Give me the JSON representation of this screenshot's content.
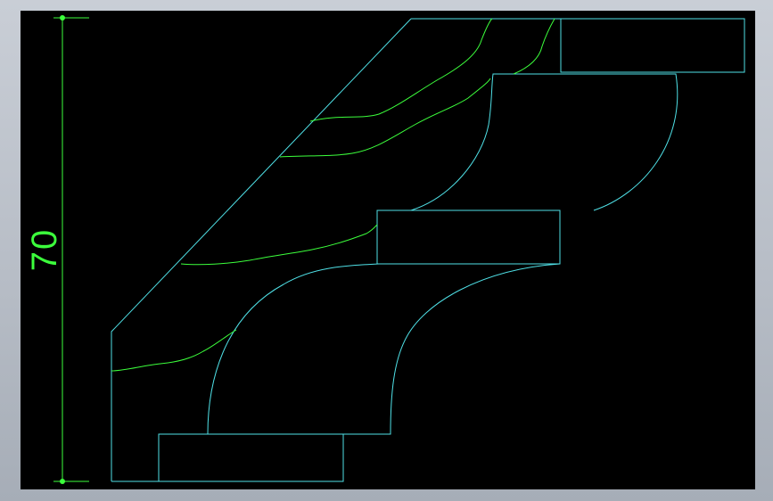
{
  "drawing": {
    "background_color": "#000000",
    "frame_color": "#b7bdc6",
    "outline_color": "#4fe0e6",
    "hatch_color": "#3cff3c",
    "dimension_color": "#3cff3c"
  },
  "dimension": {
    "value": "70"
  }
}
